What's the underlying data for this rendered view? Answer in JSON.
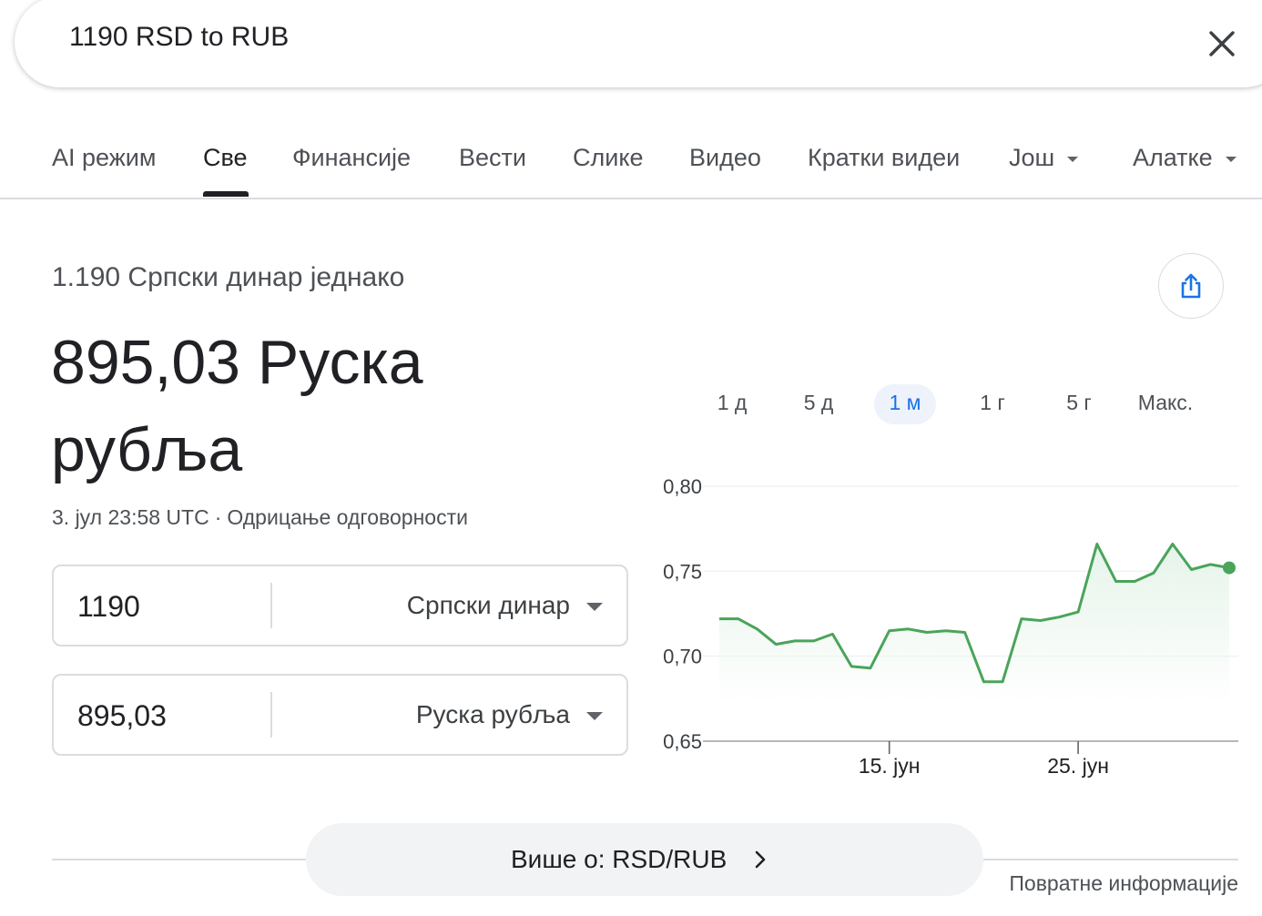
{
  "search": {
    "query": "1190 RSD to RUB"
  },
  "tabs": [
    {
      "label": "AI режим"
    },
    {
      "label": "Све",
      "active": true
    },
    {
      "label": "Финансије"
    },
    {
      "label": "Вести"
    },
    {
      "label": "Слике"
    },
    {
      "label": "Видео"
    },
    {
      "label": "Кратки видеи"
    },
    {
      "label": "Још",
      "dropdown": true
    },
    {
      "label": "Алатке",
      "dropdown": true
    }
  ],
  "result": {
    "equals_label": "1.190 Српски динар једнако",
    "value_text": "895,03 Руска рубља",
    "timestamp": "3. јул 23:58 UTC",
    "separator": "·",
    "disclaimer": "Одрицање одговорности"
  },
  "converter": {
    "from": {
      "amount": "1190",
      "currency": "Српски динар"
    },
    "to": {
      "amount": "895,03",
      "currency": "Руска рубља"
    }
  },
  "ranges": [
    "1 д",
    "5 д",
    "1 м",
    "1 г",
    "5 г",
    "Макс."
  ],
  "active_range": "1 м",
  "chart_data": {
    "type": "area",
    "y_ticks": [
      "0,80",
      "0,75",
      "0,70",
      "0,65"
    ],
    "ylim": [
      0.65,
      0.8
    ],
    "x_ticks": [
      {
        "label": "15. јун",
        "index": 9
      },
      {
        "label": "25. јун",
        "index": 19
      }
    ],
    "values": [
      0.722,
      0.722,
      0.716,
      0.707,
      0.709,
      0.709,
      0.713,
      0.694,
      0.693,
      0.715,
      0.716,
      0.714,
      0.715,
      0.714,
      0.685,
      0.685,
      0.722,
      0.721,
      0.723,
      0.726,
      0.766,
      0.744,
      0.744,
      0.749,
      0.766,
      0.751,
      0.754,
      0.752
    ],
    "line_color": "#4aa45a",
    "fill_color": "#e6f4ea"
  },
  "footer": {
    "more_label": "Више о: RSD/RUB",
    "feedback": "Повратне информације"
  },
  "colors": {
    "accent": "#1a73e8",
    "chart_green": "#4aa45a"
  }
}
